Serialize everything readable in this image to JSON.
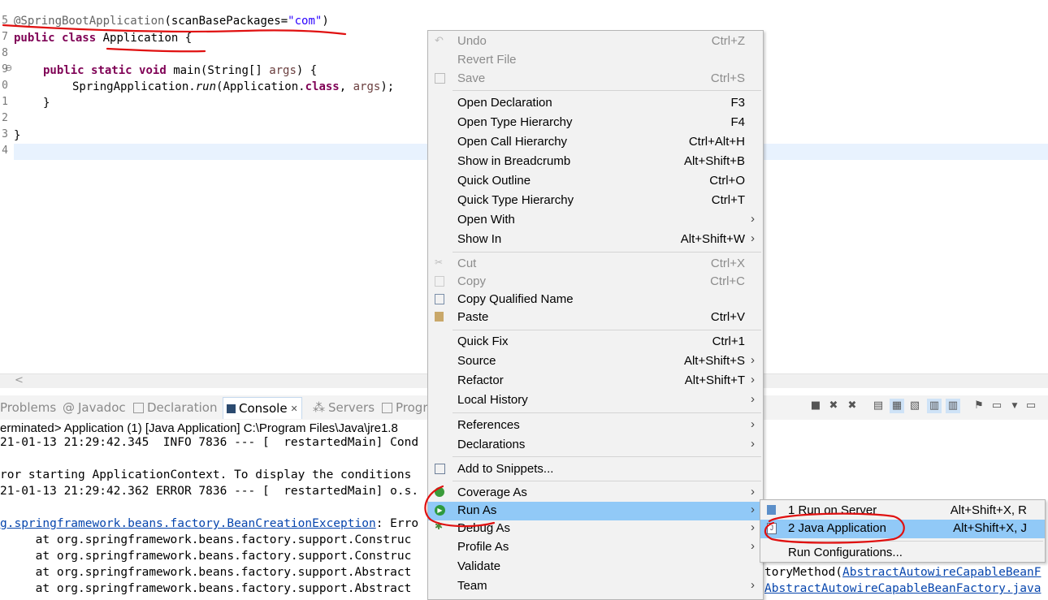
{
  "editor": {
    "line_numbers": [
      "5",
      "7",
      "8",
      "9",
      "0",
      "1",
      "2",
      "3",
      "4"
    ],
    "fold_marker": "⊖",
    "code": {
      "l1_annotation": "@SpringBootApplication",
      "l1_paren_open": "(",
      "l1_param": "scanBasePackages",
      "l1_eq": "=",
      "l1_str": "\"com\"",
      "l1_paren_close": ")",
      "l2_kw1": "public",
      "l2_kw2": "class",
      "l2_rest": "Application {",
      "l4_kw1": "public",
      "l4_kw2": "static",
      "l4_kw3": "void",
      "l4_rest": "main(String[] ",
      "l4_var": "args",
      "l4_end": ") {",
      "l5_a": "SpringApplication.",
      "l5_run": "run",
      "l5_b": "(Application.",
      "l5_kw": "class",
      "l5_c": ", ",
      "l5_var": "args",
      "l5_d": ");",
      "l6": "}",
      "l8": "}"
    }
  },
  "tabs": [
    {
      "label": "Problems"
    },
    {
      "label": "Javadoc"
    },
    {
      "label": "Declaration"
    },
    {
      "label": "Console",
      "close": "✕"
    },
    {
      "label": "Servers"
    },
    {
      "label": "Progr"
    }
  ],
  "console": {
    "terminated": "erminated> Application (1) [Java Application] C:\\Program Files\\Java\\jre1.8",
    "lines": [
      "21-01-13 21:29:42.345  INFO 7836 --- [  restartedMain] Cond",
      "",
      "ror starting ApplicationContext. To display the conditions                           abled.",
      "21-01-13 21:29:42.362 ERROR 7836 --- [  restartedMain] o.s.                         tion run failed"
    ],
    "exception_link": "g.springframework.beans.factory.BeanCreationException",
    "exception_rest": ": Erro",
    "stack": [
      "     at org.springframework.beans.factory.support.Construc",
      "     at org.springframework.beans.factory.support.Construc",
      "     at org.springframework.beans.factory.support.Abstract",
      "     at org.springframework.beans.factory.support.Abstract"
    ],
    "right_frag1_text": "toryMethod(",
    "right_frag1_link": "AbstractAutowireCapableBeanF",
    "right_frag2_link": "AbstractAutowireCapableBeanFactory.java"
  },
  "menu": {
    "items": [
      {
        "label": "Undo",
        "shortcut": "Ctrl+Z",
        "disabled": true
      },
      {
        "label": "Revert File",
        "shortcut": "",
        "disabled": true
      },
      {
        "label": "Save",
        "shortcut": "Ctrl+S",
        "disabled": true
      },
      {
        "label": "Open Declaration",
        "shortcut": "F3"
      },
      {
        "label": "Open Type Hierarchy",
        "shortcut": "F4"
      },
      {
        "label": "Open Call Hierarchy",
        "shortcut": "Ctrl+Alt+H"
      },
      {
        "label": "Show in Breadcrumb",
        "shortcut": "Alt+Shift+B"
      },
      {
        "label": "Quick Outline",
        "shortcut": "Ctrl+O"
      },
      {
        "label": "Quick Type Hierarchy",
        "shortcut": "Ctrl+T"
      },
      {
        "label": "Open With",
        "shortcut": ""
      },
      {
        "label": "Show In",
        "shortcut": "Alt+Shift+W"
      },
      {
        "label": "Cut",
        "shortcut": "Ctrl+X",
        "disabled": true
      },
      {
        "label": "Copy",
        "shortcut": "Ctrl+C",
        "disabled": true
      },
      {
        "label": "Copy Qualified Name",
        "shortcut": ""
      },
      {
        "label": "Paste",
        "shortcut": "Ctrl+V"
      },
      {
        "label": "Quick Fix",
        "shortcut": "Ctrl+1"
      },
      {
        "label": "Source",
        "shortcut": "Alt+Shift+S"
      },
      {
        "label": "Refactor",
        "shortcut": "Alt+Shift+T"
      },
      {
        "label": "Local History",
        "shortcut": ""
      },
      {
        "label": "References",
        "shortcut": ""
      },
      {
        "label": "Declarations",
        "shortcut": ""
      },
      {
        "label": "Add to Snippets...",
        "shortcut": ""
      },
      {
        "label": "Coverage As",
        "shortcut": ""
      },
      {
        "label": "Run As",
        "shortcut": ""
      },
      {
        "label": "Debug As",
        "shortcut": ""
      },
      {
        "label": "Profile As",
        "shortcut": ""
      },
      {
        "label": "Validate",
        "shortcut": ""
      },
      {
        "label": "Team",
        "shortcut": ""
      }
    ],
    "submenu_arrow": "›"
  },
  "submenu": {
    "items": [
      {
        "label": "1 Run on Server",
        "shortcut": "Alt+Shift+X, R"
      },
      {
        "label": "2 Java Application",
        "shortcut": "Alt+Shift+X, J"
      },
      {
        "label": "Run Configurations...",
        "shortcut": ""
      }
    ]
  },
  "colors": {
    "highlight": "#91c9f7",
    "annotation_red": "#e01010",
    "keyword": "#7f0055",
    "string": "#2a00ff"
  }
}
